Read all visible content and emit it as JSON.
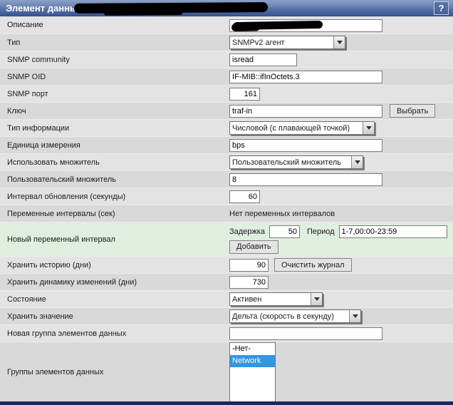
{
  "header": {
    "title": "Элемент данных '",
    "help_label": "?",
    "title_redacted": true
  },
  "colors": {
    "header_blue": "#3a5795",
    "green_row": "#dfeede",
    "selection_blue": "#3296e1",
    "bottom_bar": "#1a265c"
  },
  "form": {
    "description": {
      "label": "Описание",
      "value": "",
      "redacted": true
    },
    "type": {
      "label": "Тип",
      "value": "SNMPv2 агент"
    },
    "snmp_community": {
      "label": "SNMP community",
      "value": "isread"
    },
    "snmp_oid": {
      "label": "SNMP OID",
      "value": "IF-MIB::ifInOctets.3"
    },
    "snmp_port": {
      "label": "SNMP порт",
      "value": "161"
    },
    "key": {
      "label": "Ключ",
      "value": "traf-in",
      "button": "Выбрать"
    },
    "info_type": {
      "label": "Тип информации",
      "value": "Числовой (с плавающей точкой)"
    },
    "units": {
      "label": "Единица измерения",
      "value": "bps"
    },
    "use_multiplier": {
      "label": "Использовать множитель",
      "value": "Пользовательский множитель"
    },
    "custom_multiplier": {
      "label": "Пользовательский множитель",
      "value": "8"
    },
    "update_interval": {
      "label": "Интервал обновления (секунды)",
      "value": "60"
    },
    "flex_intervals": {
      "label": "Переменные интервалы (сек)",
      "value": "Нет переменных интервалов"
    },
    "new_flex_interval": {
      "label": "Новый переменный интервал",
      "delay_label": "Задержка",
      "delay_value": "50",
      "period_label": "Период",
      "period_value": "1-7,00:00-23:59",
      "add_button": "Добавить"
    },
    "keep_history": {
      "label": "Хранить историю (дни)",
      "value": "90",
      "button": "Очистить журнал"
    },
    "keep_trends": {
      "label": "Хранить динамику изменений (дни)",
      "value": "730"
    },
    "status": {
      "label": "Состояние",
      "value": "Активен"
    },
    "store_value": {
      "label": "Хранить значение",
      "value": "Дельта (скорость в секунду)"
    },
    "new_app_group": {
      "label": "Новая группа элементов данных",
      "value": ""
    },
    "app_groups": {
      "label": "Группы элементов данных",
      "options": [
        "-Нет-",
        "Network"
      ],
      "selected": "Network"
    }
  }
}
